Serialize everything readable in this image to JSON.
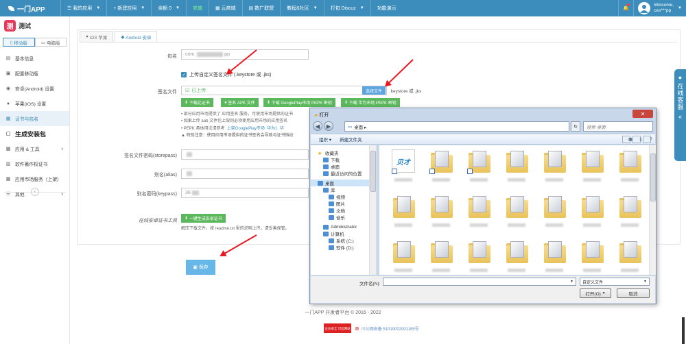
{
  "topbar": {
    "brand": "一门APP",
    "nav": [
      {
        "label": "我的应用",
        "icon": "list-icon",
        "dropdown": true
      },
      {
        "label": "新建应用",
        "icon": "plus-icon",
        "dropdown": true
      },
      {
        "label": "余额 0",
        "dropdown": true
      },
      {
        "label": "充值",
        "green": true
      },
      {
        "label": "云商城",
        "icon": "store-icon"
      },
      {
        "label": "数广联盟",
        "icon": "chart-icon"
      },
      {
        "label": "教程&社区",
        "dropdown": true
      },
      {
        "label": "打包 Discuz",
        "dropdown": true
      },
      {
        "label": "功能演示"
      }
    ],
    "welcome": "Welcome,",
    "username": "ces***pp"
  },
  "sidebar": {
    "app_name": "测试",
    "app_icon_char": "测",
    "tabs": [
      "移动版",
      "电脑版"
    ],
    "items": [
      {
        "label": "基本信息",
        "icon": "info-icon"
      },
      {
        "label": "配置移动版",
        "icon": "config-icon"
      },
      {
        "label": "安卓(Android) 设置",
        "icon": "android-icon"
      },
      {
        "label": "苹果(IOS) 设置",
        "icon": "apple-icon"
      },
      {
        "label": "证书与包名",
        "icon": "certificate-icon",
        "active": true
      },
      {
        "label": "生成安装包",
        "icon": "build-icon",
        "big": true
      },
      {
        "label": "应用 & 工具",
        "icon": "apps-icon",
        "expand": true
      },
      {
        "label": "软件著作权证书",
        "icon": "copyright-icon"
      },
      {
        "label": "应用市场服务（上架）",
        "icon": "market-icon"
      },
      {
        "label": "其他",
        "icon": "menu-icon",
        "expand": true
      }
    ],
    "collapse_icon": "‹"
  },
  "content": {
    "tabs": [
      "iOS 苹果",
      "Android 安卓"
    ],
    "package_label": "包名",
    "package_value_prefix": "com.",
    "package_value_suffix": "pp",
    "upload_custom_label": "上传自定义签名文件 (.keystore 或 .jks)",
    "sign_file_label": "签名文件",
    "sign_file_status": "已上传",
    "choose_file_btn": "选择文件",
    "file_ext_hint": ".keystore 或 .jks",
    "buttons": [
      "下载此证书",
      "签名 APK 文件",
      "下载 GooglePlay市场 PEPK 密钥",
      "下载 华为市场 PEPK 密钥"
    ],
    "notes": [
      "• 部分应用市场提供了 应用签名 服务，可使用市场提供的证书",
      "• 如果上传 aab 文件包上架则必须使用应用市场的应用签名",
      "• PEPK 具体用法请参考",
      "▲ 特别注意：使用应用市场提供的证书签名会导致与证书指纹"
    ],
    "pepk_links": [
      "上架GooglePlay市场",
      "华为1",
      "华"
    ],
    "storepass_label": "签名文件密码(storepass)",
    "alias_label": "别名(alias)",
    "keypass_label": "别名密码(keypass)",
    "keypass_prefix": "36",
    "online_cert_label": "在线安卓证书工具",
    "online_cert_btn": "一键生成安卓证书",
    "online_cert_note": "解压下载文件，按 readme.txt 里的说明上传，请妥善保管。",
    "save_btn": "保存"
  },
  "footer": {
    "copyright": "一门APP 开发者平台 © 2016 - 2022",
    "beian_logo": "企业安全 可信网站",
    "beian_text": "川公网安备 51019002001185号"
  },
  "customer_service": "在线客服",
  "dialog": {
    "title": "打开",
    "address": "桌面 ▸",
    "search_placeholder": "搜索 桌面",
    "toolbar": [
      "组织 ▾",
      "新建文件夹"
    ],
    "tree": [
      {
        "label": "收藏夹",
        "indent": 0,
        "icon": "star-icon"
      },
      {
        "label": "下载",
        "indent": 1
      },
      {
        "label": "桌面",
        "indent": 1
      },
      {
        "label": "最近访问的位置",
        "indent": 1
      },
      {
        "label": "桌面",
        "indent": 0,
        "selected": true
      },
      {
        "label": "库",
        "indent": 1
      },
      {
        "label": "视频",
        "indent": 2
      },
      {
        "label": "图片",
        "indent": 2
      },
      {
        "label": "文档",
        "indent": 2
      },
      {
        "label": "音乐",
        "indent": 2
      },
      {
        "label": "Administrator",
        "indent": 1
      },
      {
        "label": "计算机",
        "indent": 1
      },
      {
        "label": "系统 (C:)",
        "indent": 2
      },
      {
        "label": "软件 (D:)",
        "indent": 2
      }
    ],
    "first_file_logo": "贝才",
    "filename_label": "文件名(N):",
    "filetype": "自定义文件",
    "open_btn": "打开(O)",
    "cancel_btn": "取消"
  }
}
